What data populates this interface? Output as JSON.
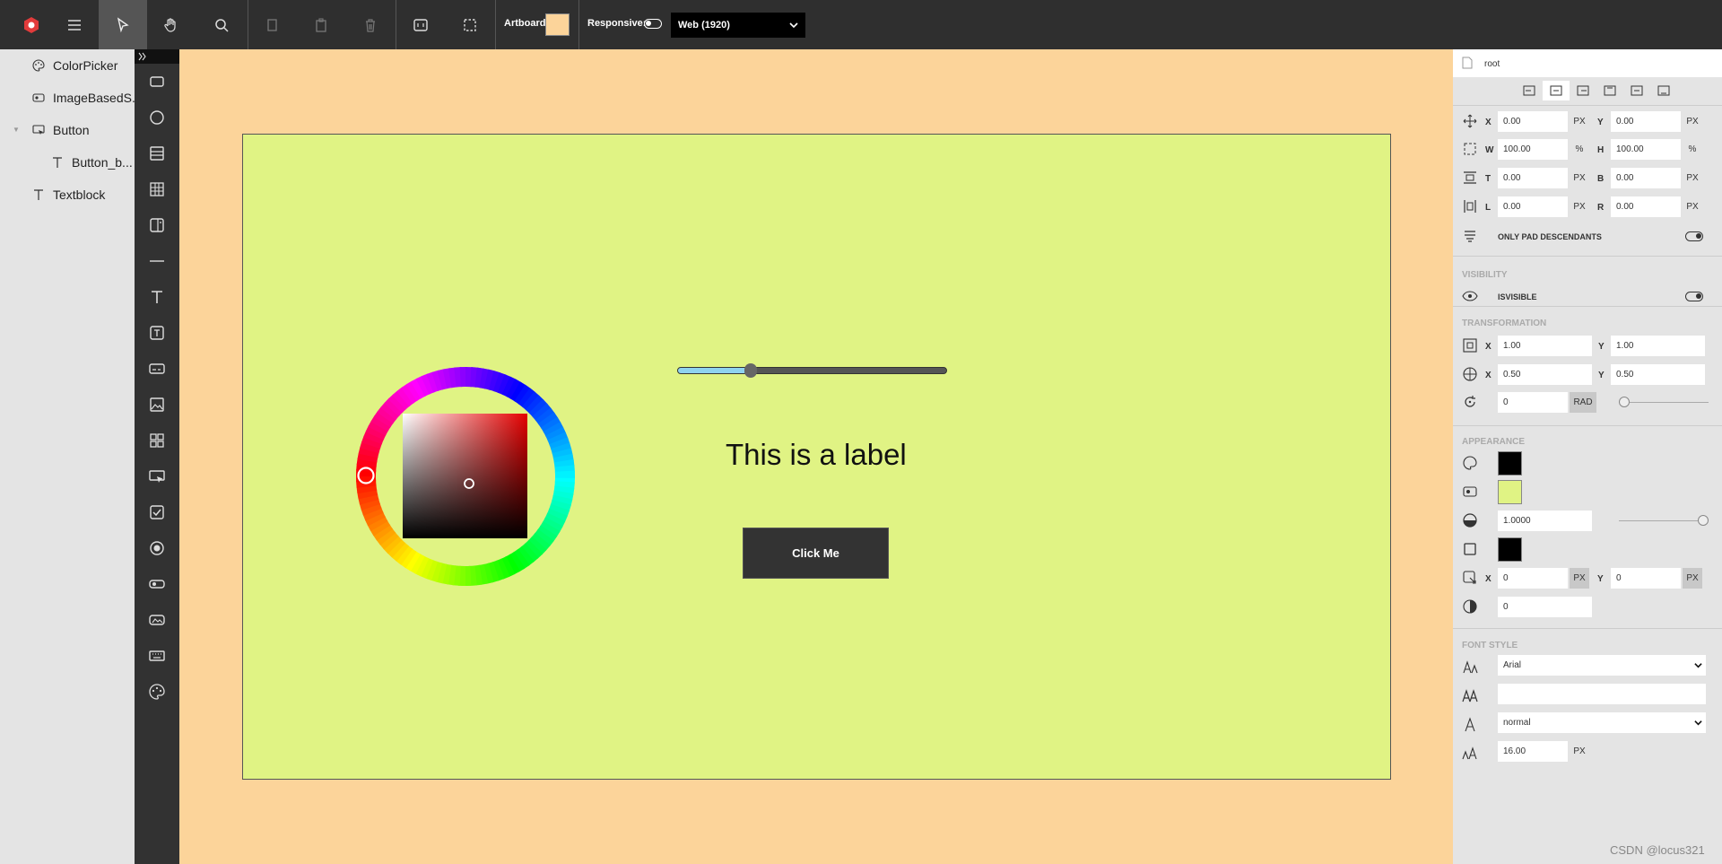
{
  "toolbar": {
    "artboard_label": "Artboard:",
    "artboard_color": "#fcd49a",
    "responsive_label": "Responsive:",
    "device_select": "Web (1920)"
  },
  "layers": [
    {
      "label": "ColorPicker",
      "icon": "palette-icon"
    },
    {
      "label": "ImageBasedS...",
      "icon": "image-slider-icon"
    },
    {
      "label": "Button",
      "icon": "button-icon"
    },
    {
      "label": "Button_b...",
      "icon": "text-icon"
    },
    {
      "label": "Textblock",
      "icon": "text-icon"
    }
  ],
  "stage": {
    "background": "#e0f384",
    "label": "This is a label",
    "button_label": "Click Me",
    "slider_value": 0.27
  },
  "props": {
    "root_label": "root",
    "x": "0.00",
    "x_unit": "PX",
    "y": "0.00",
    "y_unit": "PX",
    "w": "100.00",
    "w_unit": "%",
    "h": "100.00",
    "h_unit": "%",
    "t": "0.00",
    "t_unit": "PX",
    "b": "0.00",
    "b_unit": "PX",
    "l": "0.00",
    "l_unit": "PX",
    "r": "0.00",
    "r_unit": "PX",
    "only_pad_label": "ONLY PAD DESCENDANTS",
    "visibility_section": "VISIBILITY",
    "isvisible_label": "ISVISIBLE",
    "transformation_section": "TRANSFORMATION",
    "scale_x": "1.00",
    "scale_y": "1.00",
    "pivot_x": "0.50",
    "pivot_y": "0.50",
    "rotation": "0",
    "rotation_unit": "RAD",
    "appearance_section": "APPEARANCE",
    "foreground_color": "#000000",
    "background_color": "#e0f384",
    "opacity": "1.0000",
    "border_color": "#000000",
    "shadow_x": "0",
    "shadow_x_unit": "PX",
    "shadow_y": "0",
    "shadow_y_unit": "PX",
    "radius": "0",
    "font_section": "FONT STYLE",
    "font_family": "Arial",
    "font_weight": "normal",
    "font_size": "16.00",
    "font_size_unit": "PX",
    "labels": {
      "x": "X",
      "y": "Y",
      "w": "W",
      "h": "H",
      "t": "T",
      "b": "B",
      "l": "L",
      "r": "R"
    }
  },
  "watermark": "CSDN @locus321"
}
